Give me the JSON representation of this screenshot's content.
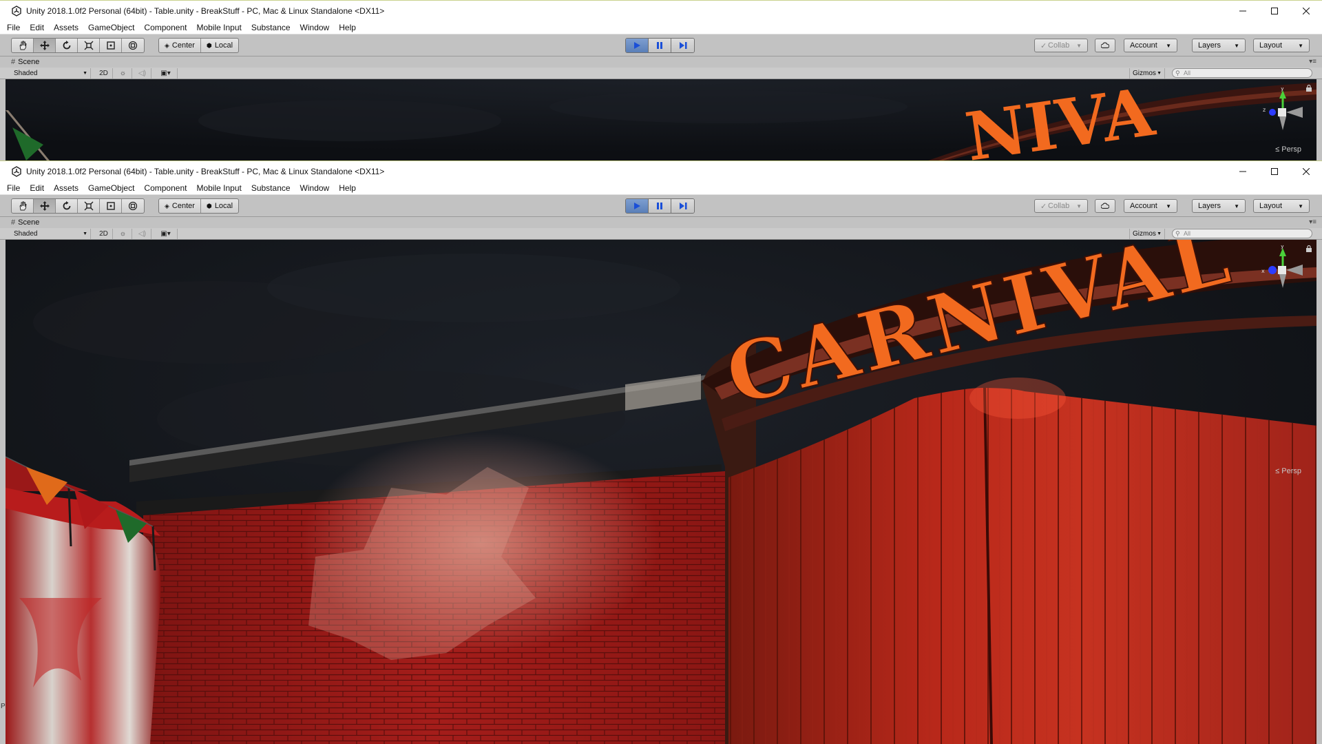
{
  "window_title": "Unity 2018.1.0f2 Personal (64bit) - Table.unity - BreakStuff - PC, Mac & Linux Standalone <DX11>",
  "menu": [
    "File",
    "Edit",
    "Assets",
    "GameObject",
    "Component",
    "Mobile Input",
    "Substance",
    "Window",
    "Help"
  ],
  "toolbar": {
    "transform_tools": [
      "hand-icon",
      "move-icon",
      "rotate-icon",
      "scale-icon",
      "rect-icon",
      "transform-icon"
    ],
    "pivot_label": "Center",
    "space_label": "Local",
    "collab_label": "Collab",
    "account_label": "Account",
    "layers_label": "Layers",
    "layout_label": "Layout"
  },
  "scene": {
    "tab_label": "Scene",
    "shading_mode": "Shaded",
    "mode_2d_label": "2D",
    "gizmos_label": "Gizmos",
    "search_placeholder": "All",
    "projection_label": "Persp",
    "axis_labels": {
      "y": "y",
      "x": "x",
      "z": "z"
    }
  },
  "viewport_scene": {
    "sign_text": "CARNIVAL",
    "partial_sign_text": "NIVA",
    "colors": {
      "sky": "#15181e",
      "sign_orange": "#f26a1f",
      "brick_red": "#a11d1a",
      "gate_red": "#b8281a",
      "tent_white": "#d8d2cc",
      "flag_orange": "#e06a1a",
      "flag_red": "#b0181a",
      "flag_green": "#1f6a2a"
    }
  },
  "side_letters": [
    "P",
    "P"
  ],
  "colors": {
    "play_active": "#5a7fb8",
    "toolbar_bg": "#c2c2c2",
    "titlebar_bg": "#ffffff"
  }
}
